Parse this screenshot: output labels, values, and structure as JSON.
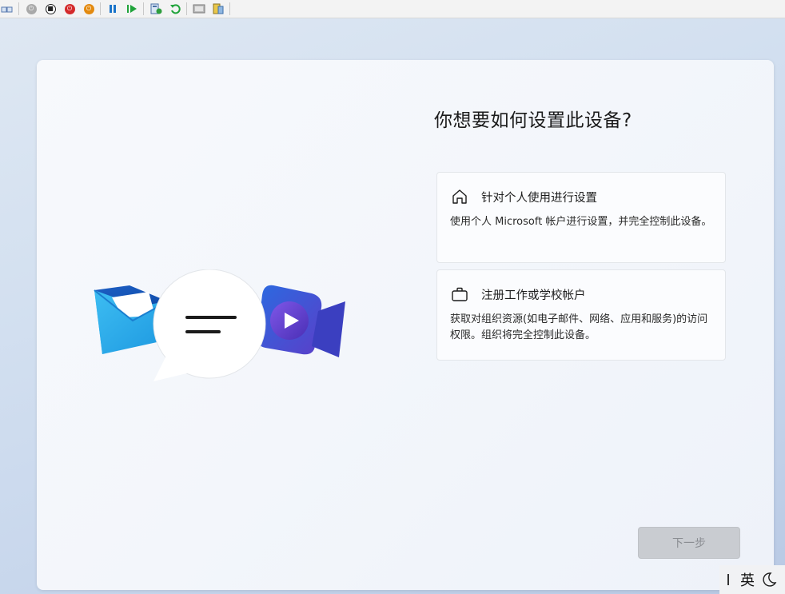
{
  "toolbar": {
    "items": [
      {
        "name": "ctrl-alt-del-icon"
      },
      {
        "name": "start-icon"
      },
      {
        "name": "turn-off-icon"
      },
      {
        "name": "shutdown-icon"
      },
      {
        "name": "power-icon"
      },
      {
        "name": "pause-icon"
      },
      {
        "name": "resume-icon"
      },
      {
        "name": "checkpoint-icon"
      },
      {
        "name": "revert-icon"
      },
      {
        "name": "enhanced-session-icon"
      },
      {
        "name": "share-icon"
      }
    ]
  },
  "oobe": {
    "title": "你想要如何设置此设备?",
    "options": [
      {
        "icon": "home-icon",
        "label": "针对个人使用进行设置",
        "description": "使用个人 Microsoft 帐户进行设置，并完全控制此设备。"
      },
      {
        "icon": "briefcase-icon",
        "label": "注册工作或学校帐户",
        "description": "获取对组织资源(如电子邮件、网络、应用和服务)的访问权限。组织将完全控制此设备。"
      }
    ],
    "next_label": "下一步"
  },
  "tray": {
    "ime_label": "英",
    "moon_icon": "moon-icon"
  },
  "colors": {
    "accent_blue": "#1f6fd6",
    "next_disabled_bg": "#c9ccd1"
  }
}
